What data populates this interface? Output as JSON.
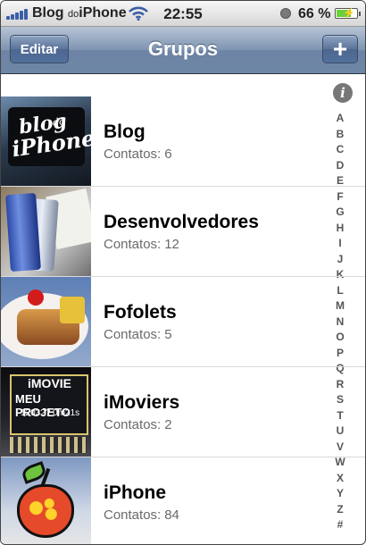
{
  "status_bar": {
    "carrier_main": "Blog",
    "carrier_small": "do",
    "carrier_end": "iPhone",
    "time": "22:55",
    "battery_percent": "66 %",
    "battery_level": 0.66,
    "icons": [
      "signal-bars-icon",
      "wifi-icon",
      "orientation-lock-icon",
      "battery-charging-icon"
    ]
  },
  "nav_bar": {
    "title": "Grupos",
    "edit_label": "Editar",
    "add_label": "+"
  },
  "groups": [
    {
      "name": "Blog",
      "contacts_label": "Contatos:",
      "count": "6",
      "thumb": "blog-do-iphone-photo"
    },
    {
      "name": "Desenvolvedores",
      "contacts_label": "Contatos:",
      "count": "12",
      "thumb": "drink-cans-photo"
    },
    {
      "name": "Fofolets",
      "contacts_label": "Contatos:",
      "count": "5",
      "thumb": "dessert-plate-photo"
    },
    {
      "name": "iMoviers",
      "contacts_label": "Contatos:",
      "count": "2",
      "thumb": "imovie-marquee-photo"
    },
    {
      "name": "iPhone",
      "contacts_label": "Contatos:",
      "count": "84",
      "thumb": "apple-art-photo"
    }
  ],
  "index": {
    "info_glyph": "i",
    "letters": [
      "A",
      "B",
      "C",
      "D",
      "E",
      "F",
      "G",
      "H",
      "I",
      "J",
      "K",
      "L",
      "M",
      "N",
      "O",
      "P",
      "Q",
      "R",
      "S",
      "T",
      "U",
      "V",
      "W",
      "X",
      "Y",
      "Z",
      "#"
    ]
  },
  "thumb_text": {
    "blog_line1": "blog",
    "blog_small": "do",
    "blog_line2": "iPhone",
    "imovie_line1": "iMOVIE",
    "imovie_line2": "MEU PROJETO",
    "imovie_line3": "1203?? 0m21s"
  }
}
